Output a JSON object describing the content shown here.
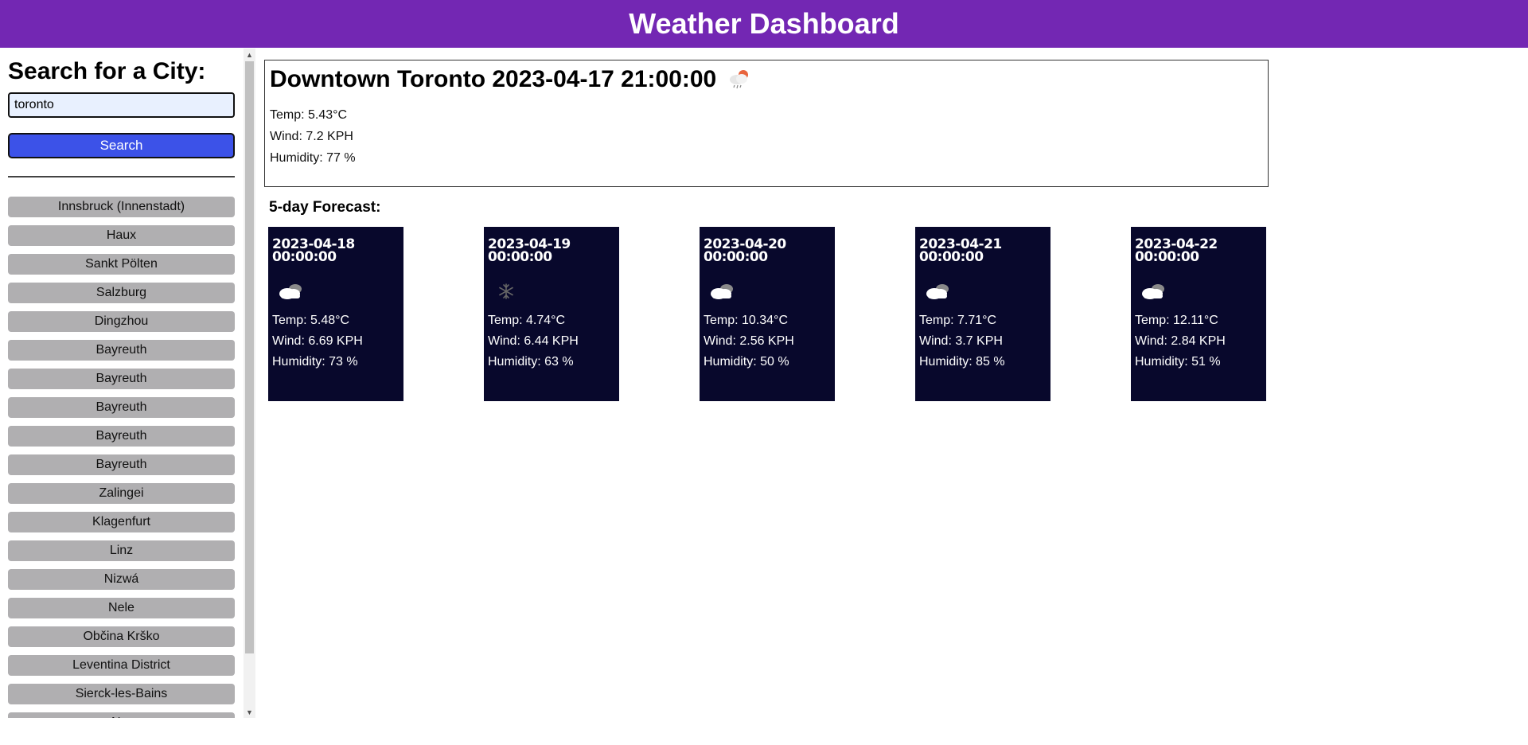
{
  "header": {
    "title": "Weather Dashboard"
  },
  "sidebar": {
    "heading": "Search for a City:",
    "search_value": "toronto",
    "search_button": "Search",
    "history": [
      "Innsbruck (Innenstadt)",
      "Haux",
      "Sankt Pölten",
      "Salzburg",
      "Dingzhou",
      "Bayreuth",
      "Bayreuth",
      "Bayreuth",
      "Bayreuth",
      "Bayreuth",
      "Zalingei",
      "Klagenfurt",
      "Linz",
      "Nizwá",
      "Nele",
      "Občina Krško",
      "Leventina District",
      "Sierck-les-Bains",
      "N..."
    ]
  },
  "current": {
    "title": "Downtown Toronto 2023-04-17 21:00:00",
    "icon": "rain-cloud-icon",
    "temp": "Temp: 5.43°C",
    "wind": "Wind: 7.2 KPH",
    "humidity": "Humidity: 77 %"
  },
  "forecast": {
    "title": "5-day Forecast:",
    "days": [
      {
        "date": "2023-04-18 00:00:00",
        "icon": "cloud-icon",
        "temp": "Temp: 5.48°C",
        "wind": "Wind: 6.69 KPH",
        "humidity": "Humidity: 73 %"
      },
      {
        "date": "2023-04-19 00:00:00",
        "icon": "snow-icon",
        "temp": "Temp: 4.74°C",
        "wind": "Wind: 6.44 KPH",
        "humidity": "Humidity: 63 %"
      },
      {
        "date": "2023-04-20 00:00:00",
        "icon": "cloud-icon",
        "temp": "Temp: 10.34°C",
        "wind": "Wind: 2.56 KPH",
        "humidity": "Humidity: 50 %"
      },
      {
        "date": "2023-04-21 00:00:00",
        "icon": "cloud-icon",
        "temp": "Temp: 7.71°C",
        "wind": "Wind: 3.7 KPH",
        "humidity": "Humidity: 85 %"
      },
      {
        "date": "2023-04-22 00:00:00",
        "icon": "cloud-icon",
        "temp": "Temp: 12.11°C",
        "wind": "Wind: 2.84 KPH",
        "humidity": "Humidity: 51 %"
      }
    ]
  },
  "colors": {
    "header_bg": "#7327b3",
    "search_button_bg": "#3c52e8",
    "history_button_bg": "#b0afb1",
    "card_bg": "#08082c"
  }
}
